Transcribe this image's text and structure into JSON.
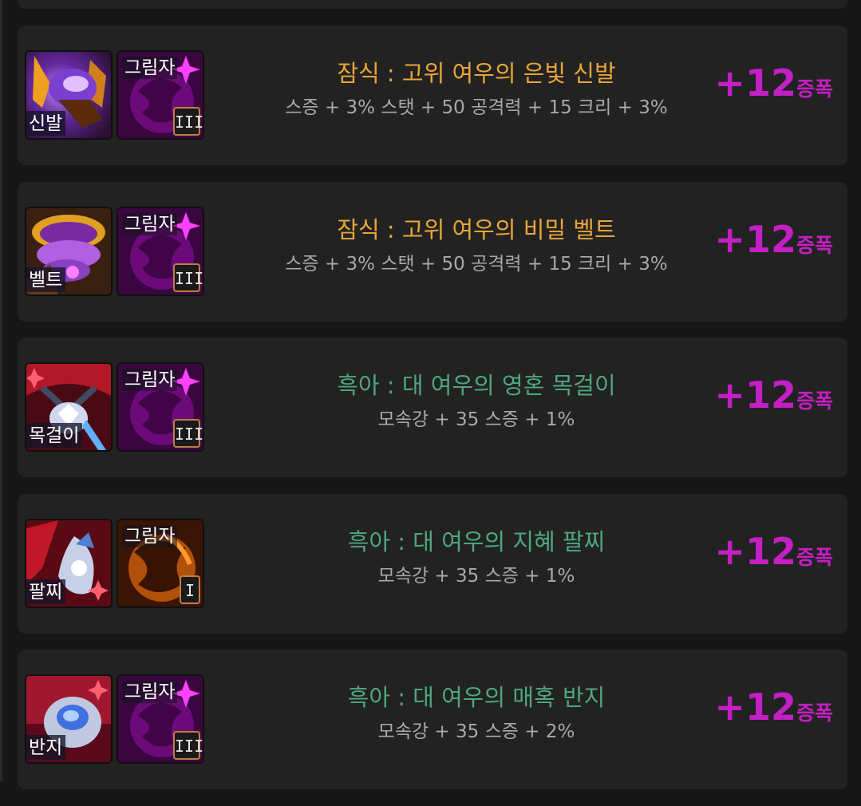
{
  "colors": {
    "orange_title": "#e9a637",
    "green_title": "#4ea77f",
    "amp": "#c41fc4",
    "card_bg": "#222222",
    "page_bg": "#161616"
  },
  "items": [
    {
      "slot_label": "신발",
      "item_icon": "shoes-icon",
      "shadow_label": "그림자",
      "shadow_icon": "shadow-emblem-icon",
      "grade": "III",
      "title": "잠식 : 고위 여우의 은빛 신발",
      "title_color": "#e9a637",
      "stats": "스증 + 3% 스탯 + 50 공격력 + 15 크리 + 3%",
      "amp_value": "+12",
      "amp_unit": "증폭"
    },
    {
      "slot_label": "벨트",
      "item_icon": "belt-icon",
      "shadow_label": "그림자",
      "shadow_icon": "shadow-emblem-icon",
      "grade": "III",
      "title": "잠식 : 고위 여우의 비밀 벨트",
      "title_color": "#e9a637",
      "stats": "스증 + 3% 스탯 + 50 공격력 + 15 크리 + 3%",
      "amp_value": "+12",
      "amp_unit": "증폭"
    },
    {
      "slot_label": "목걸이",
      "item_icon": "necklace-icon",
      "shadow_label": "그림자",
      "shadow_icon": "shadow-emblem-icon",
      "grade": "III",
      "title": "흑아 : 대 여우의 영혼 목걸이",
      "title_color": "#4ea77f",
      "stats": "모속강 + 35 스증 + 1%",
      "amp_value": "+12",
      "amp_unit": "증폭"
    },
    {
      "slot_label": "팔찌",
      "item_icon": "bracelet-icon",
      "shadow_label": "그림자",
      "shadow_icon": "shadow-emblem-orange-icon",
      "grade": "I",
      "title": "흑아 : 대 여우의 지혜 팔찌",
      "title_color": "#4ea77f",
      "stats": "모속강 + 35 스증 + 1%",
      "amp_value": "+12",
      "amp_unit": "증폭"
    },
    {
      "slot_label": "반지",
      "item_icon": "ring-icon",
      "shadow_label": "그림자",
      "shadow_icon": "shadow-emblem-icon",
      "grade": "III",
      "title": "흑아 : 대 여우의 매혹 반지",
      "title_color": "#4ea77f",
      "stats": "모속강 + 35 스증 + 2%",
      "amp_value": "+12",
      "amp_unit": "증폭"
    }
  ]
}
